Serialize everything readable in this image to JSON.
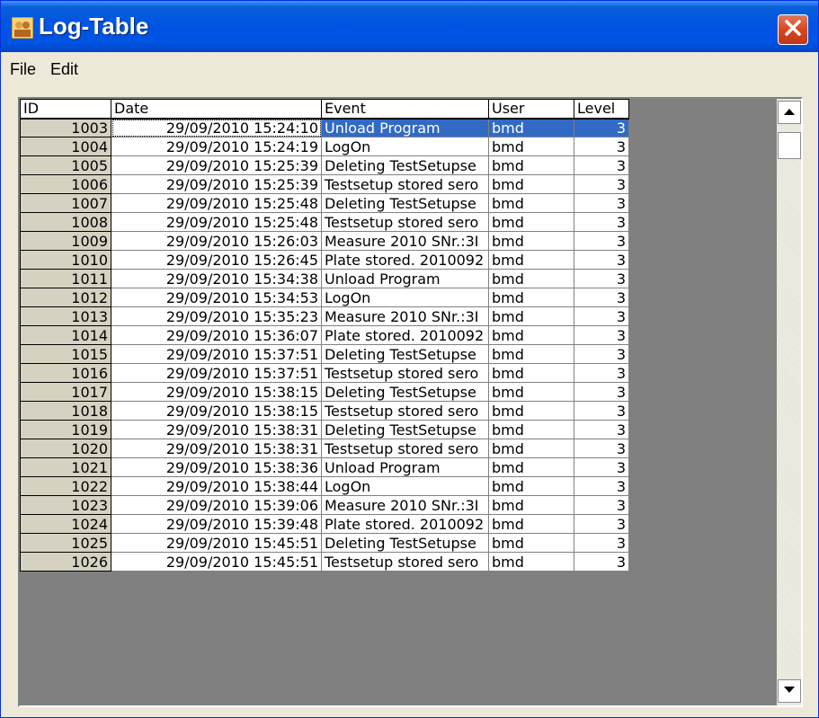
{
  "window": {
    "title": "Log-Table",
    "icon": "log-table-app-icon"
  },
  "menu": [
    "File",
    "Edit"
  ],
  "table": {
    "columns": [
      "ID",
      "Date",
      "Event",
      "User",
      "Level"
    ],
    "selected_id": "1003",
    "rows": [
      {
        "id": "1003",
        "date": "29/09/2010 15:24:10",
        "event": "Unload Program",
        "user": "bmd",
        "level": "3"
      },
      {
        "id": "1004",
        "date": "29/09/2010 15:24:19",
        "event": "LogOn",
        "user": "bmd",
        "level": "3"
      },
      {
        "id": "1005",
        "date": "29/09/2010 15:25:39",
        "event": "Deleting TestSetupse",
        "user": "bmd",
        "level": "3"
      },
      {
        "id": "1006",
        "date": "29/09/2010 15:25:39",
        "event": "Testsetup stored sero",
        "user": "bmd",
        "level": "3"
      },
      {
        "id": "1007",
        "date": "29/09/2010 15:25:48",
        "event": "Deleting TestSetupse",
        "user": "bmd",
        "level": "3"
      },
      {
        "id": "1008",
        "date": "29/09/2010 15:25:48",
        "event": "Testsetup stored sero",
        "user": "bmd",
        "level": "3"
      },
      {
        "id": "1009",
        "date": "29/09/2010 15:26:03",
        "event": "Measure 2010 SNr.:3I",
        "user": "bmd",
        "level": "3"
      },
      {
        "id": "1010",
        "date": "29/09/2010 15:26:45",
        "event": "Plate stored. 2010092",
        "user": "bmd",
        "level": "3"
      },
      {
        "id": "1011",
        "date": "29/09/2010 15:34:38",
        "event": "Unload Program",
        "user": "bmd",
        "level": "3"
      },
      {
        "id": "1012",
        "date": "29/09/2010 15:34:53",
        "event": "LogOn",
        "user": "bmd",
        "level": "3"
      },
      {
        "id": "1013",
        "date": "29/09/2010 15:35:23",
        "event": "Measure 2010 SNr.:3I",
        "user": "bmd",
        "level": "3"
      },
      {
        "id": "1014",
        "date": "29/09/2010 15:36:07",
        "event": "Plate stored. 2010092",
        "user": "bmd",
        "level": "3"
      },
      {
        "id": "1015",
        "date": "29/09/2010 15:37:51",
        "event": "Deleting TestSetupse",
        "user": "bmd",
        "level": "3"
      },
      {
        "id": "1016",
        "date": "29/09/2010 15:37:51",
        "event": "Testsetup stored sero",
        "user": "bmd",
        "level": "3"
      },
      {
        "id": "1017",
        "date": "29/09/2010 15:38:15",
        "event": "Deleting TestSetupse",
        "user": "bmd",
        "level": "3"
      },
      {
        "id": "1018",
        "date": "29/09/2010 15:38:15",
        "event": "Testsetup stored sero",
        "user": "bmd",
        "level": "3"
      },
      {
        "id": "1019",
        "date": "29/09/2010 15:38:31",
        "event": "Deleting TestSetupse",
        "user": "bmd",
        "level": "3"
      },
      {
        "id": "1020",
        "date": "29/09/2010 15:38:31",
        "event": "Testsetup stored sero",
        "user": "bmd",
        "level": "3"
      },
      {
        "id": "1021",
        "date": "29/09/2010 15:38:36",
        "event": "Unload Program",
        "user": "bmd",
        "level": "3"
      },
      {
        "id": "1022",
        "date": "29/09/2010 15:38:44",
        "event": "LogOn",
        "user": "bmd",
        "level": "3"
      },
      {
        "id": "1023",
        "date": "29/09/2010 15:39:06",
        "event": "Measure 2010 SNr.:3I",
        "user": "bmd",
        "level": "3"
      },
      {
        "id": "1024",
        "date": "29/09/2010 15:39:48",
        "event": "Plate stored. 2010092",
        "user": "bmd",
        "level": "3"
      },
      {
        "id": "1025",
        "date": "29/09/2010 15:45:51",
        "event": "Deleting TestSetupse",
        "user": "bmd",
        "level": "3"
      },
      {
        "id": "1026",
        "date": "29/09/2010 15:45:51",
        "event": "Testsetup stored sero",
        "user": "bmd",
        "level": "3"
      }
    ]
  },
  "scrollbar": {
    "up_icon": "scroll-up-arrow-icon",
    "down_icon": "scroll-down-arrow-icon"
  },
  "colors": {
    "titlebar": "#0054e3",
    "selection": "#316ac5",
    "close_button": "#d8461e",
    "grid_background": "#808080"
  }
}
